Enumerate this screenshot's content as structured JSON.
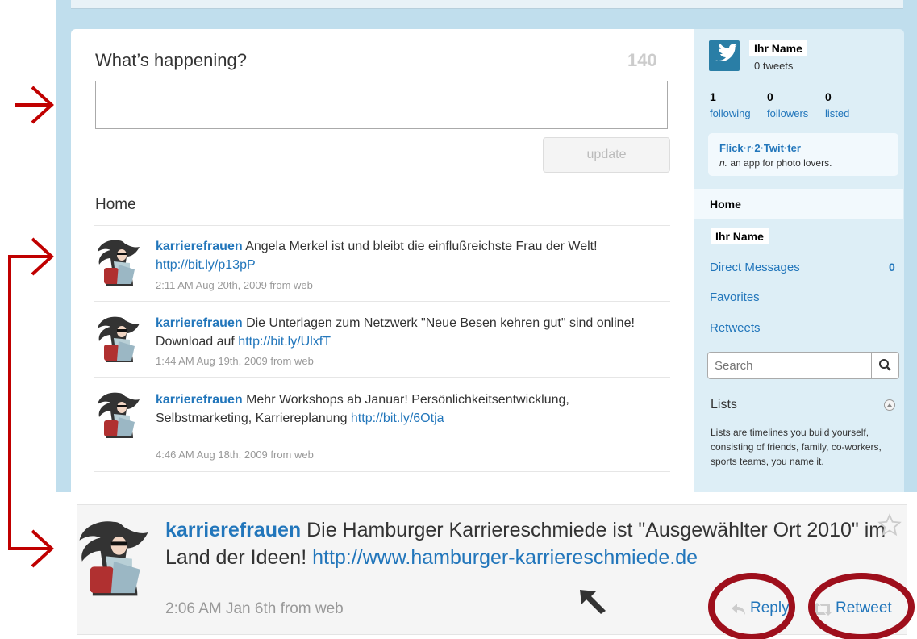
{
  "composer": {
    "prompt": "What’s happening?",
    "counter": "140",
    "update_label": "update"
  },
  "timeline": {
    "heading": "Home",
    "tweets": [
      {
        "user": "karrierefrauen",
        "text": " Angela Merkel ist und bleibt die einflußreichste Frau der Welt! ",
        "link": "http://bit.ly/p13pP",
        "meta": "2:11 AM Aug 20th, 2009 from web"
      },
      {
        "user": "karrierefrauen",
        "text": " Die Unterlagen zum Netzwerk \"Neue Besen kehren gut\" sind online! Download auf ",
        "link": "http://bit.ly/UlxfT",
        "meta": "1:44 AM Aug 19th, 2009 from web"
      },
      {
        "user": "karrierefrauen",
        "text": " Mehr Workshops ab Januar! Persönlichkeitsentwicklung, Selbstmarketing, Karriereplanung ",
        "link": "http://bit.ly/6Otja",
        "meta": "4:46 AM Aug 18th, 2009 from web"
      }
    ]
  },
  "sidebar": {
    "name": "Ihr Name",
    "tweets_count": "0 tweets",
    "stats": [
      {
        "number": "1",
        "label": "following"
      },
      {
        "number": "0",
        "label": "followers"
      },
      {
        "number": "0",
        "label": "listed"
      }
    ],
    "ad": {
      "title": "Flick·r·2·Twit·ter",
      "pos": "n.",
      "desc": " an app for photo lovers."
    },
    "nav": {
      "home": "Home",
      "name": "Ihr Name",
      "direct_messages": "Direct Messages",
      "dm_count": "0",
      "favorites": "Favorites",
      "retweets": "Retweets"
    },
    "search_placeholder": "Search",
    "lists_title": "Lists",
    "lists_desc": "Lists are timelines you build yourself, consisting of friends, family, co-workers, sports teams, you name it."
  },
  "featured": {
    "user": "karrierefrauen",
    "text": " Die Hamburger Karriereschmiede ist \"Ausgewählter Ort 2010\" im Land der Ideen! ",
    "link": "http://www.hamburger-karriereschmiede.de",
    "meta": "2:06 AM Jan 6th from web",
    "reply_label": "Reply",
    "retweet_label": "Retweet"
  },
  "colors": {
    "annotation": "#c00000",
    "link": "#2276bb",
    "background": "#c0deed"
  },
  "icons": [
    "twitter-bird-icon",
    "search-icon",
    "collapse-icon",
    "star-icon",
    "reply-icon",
    "retweet-icon",
    "arrow-icon",
    "cursor-icon"
  ]
}
